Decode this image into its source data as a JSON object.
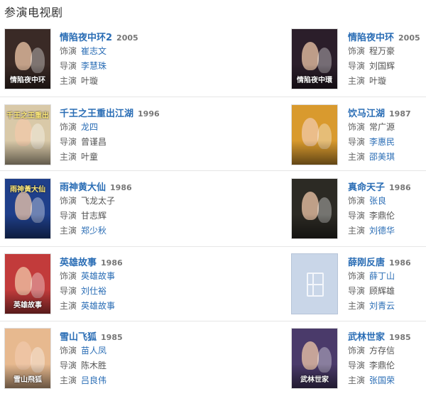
{
  "section_title": "参演电视剧",
  "labels": {
    "role": "饰演",
    "director": "导演",
    "star": "主演"
  },
  "cards": [
    {
      "title": "情陷夜中环2",
      "year": "2005",
      "role": "崔志文",
      "role_link": true,
      "director": "李慧珠",
      "director_link": true,
      "star": "叶璇",
      "star_link": false,
      "poster_caption": "情陷夜中环",
      "poster_color": "#3a2a26",
      "placeholder": false
    },
    {
      "title": "情陷夜中环",
      "year": "2005",
      "role": "程万豪",
      "role_link": false,
      "director": "刘国辉",
      "director_link": false,
      "star": "叶璇",
      "star_link": false,
      "poster_caption": "情陷夜中環",
      "poster_color": "#2b1e2a",
      "placeholder": false
    },
    {
      "title": "千王之王重出江湖",
      "year": "1996",
      "role": "龙四",
      "role_link": true,
      "director": "曾谨昌",
      "director_link": false,
      "star": "叶童",
      "star_link": false,
      "poster_caption": "千王之王重出江湖",
      "poster_color": "#d9c9a8",
      "placeholder": false
    },
    {
      "title": "饮马江湖",
      "year": "1987",
      "role": "常广源",
      "role_link": false,
      "director": "李惠民",
      "director_link": true,
      "star": "邵美琪",
      "star_link": true,
      "poster_caption": "",
      "poster_color": "#d99a2e",
      "placeholder": false
    },
    {
      "title": "雨神黄大仙",
      "year": "1986",
      "role": "飞龙太子",
      "role_link": false,
      "director": "甘志辉",
      "director_link": false,
      "star": "郑少秋",
      "star_link": true,
      "poster_caption": "雨神黃大仙",
      "poster_color": "#1f3f8a",
      "placeholder": false
    },
    {
      "title": "真命天子",
      "year": "1986",
      "role": "张良",
      "role_link": true,
      "director": "李鼎伦",
      "director_link": false,
      "star": "刘德华",
      "star_link": true,
      "poster_caption": "",
      "poster_color": "#2c2a24",
      "placeholder": false
    },
    {
      "title": "英雄故事",
      "year": "1986",
      "role": "英雄故事",
      "role_link": true,
      "director": "刘仕裕",
      "director_link": true,
      "star": "英雄故事",
      "star_link": true,
      "poster_caption": "英雄故事",
      "poster_color": "#c23b3b",
      "placeholder": false
    },
    {
      "title": "薛刚反唐",
      "year": "1986",
      "role": "薛丁山",
      "role_link": true,
      "director": "顾辉雄",
      "director_link": false,
      "star": "刘青云",
      "star_link": true,
      "poster_caption": "",
      "poster_color": "#c9d6e8",
      "placeholder": true
    },
    {
      "title": "雪山飞狐",
      "year": "1985",
      "role": "苗人凤",
      "role_link": true,
      "director": "陈木胜",
      "director_link": false,
      "star": "吕良伟",
      "star_link": true,
      "poster_caption": "雪山飛狐",
      "poster_color": "#e7b98f",
      "placeholder": false
    },
    {
      "title": "武林世家",
      "year": "1985",
      "role": "方存信",
      "role_link": false,
      "director": "李鼎伦",
      "director_link": false,
      "star": "张国荣",
      "star_link": true,
      "poster_caption": "武林世家",
      "poster_color": "#4a3a6a",
      "placeholder": false
    }
  ]
}
